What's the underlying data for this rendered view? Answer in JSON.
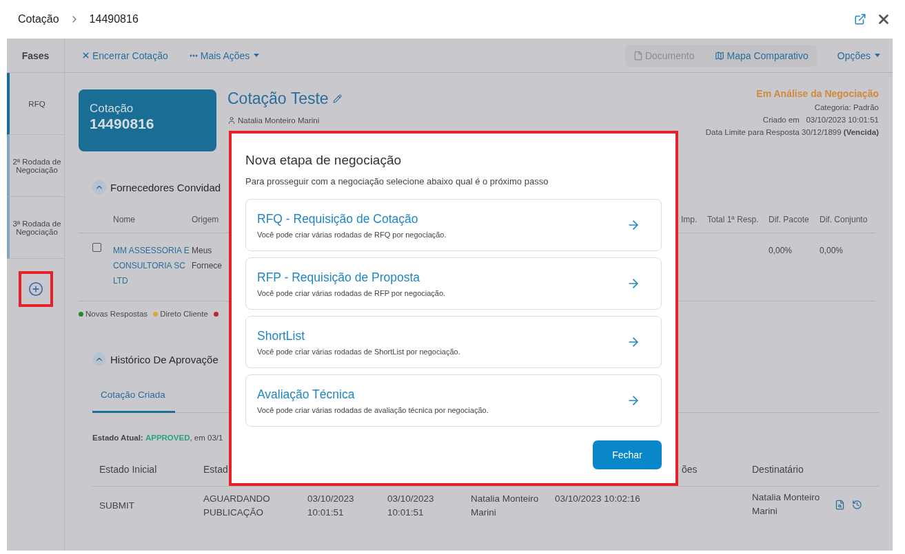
{
  "breadcrumb": [
    "Cotação",
    "14490816"
  ],
  "sidebar": {
    "title": "Fases",
    "items": [
      {
        "label": "RFQ",
        "selected": true
      },
      {
        "label": "2ª Rodada de Negociação",
        "selected": false
      },
      {
        "label": "3ª Rodada de Negociação",
        "selected": false
      }
    ]
  },
  "toolbar": {
    "left": [
      {
        "label": "Encerrar Cotação",
        "kind": "close"
      },
      {
        "label": "Mais Ações",
        "kind": "more"
      }
    ],
    "right": [
      {
        "label": "Documento",
        "kind": "document",
        "disabled": true
      },
      {
        "label": "Mapa Comparativo",
        "kind": "map",
        "disabled": false
      }
    ],
    "options": "Opções"
  },
  "quote": {
    "card_label": "Cotação",
    "card_number": "14490816",
    "title": "Cotação Teste",
    "owner": "Natalia Monteiro Marini",
    "status": "Em Análise da Negociação",
    "category": "Categoria: Padrão",
    "created_label": "Criado em",
    "created_value": "03/10/2023 10:01:51",
    "deadline": "Data Limite para Resposta 30/12/1899 **(Vencida)**"
  },
  "suppliers": {
    "heading": "Fornecedores Convidad",
    "expanded": true,
    "columns": {
      "nome": "Nome",
      "origem": "Origem",
      "column_3": "Imp.",
      "total": "Total 1ª Resp.",
      "pacote": "Dif. Pacote",
      "conjunto": "Dif. Conjunto"
    },
    "rows": [
      {
        "checked": false,
        "name": "MM ASSESSORIA E CONSULTORIA SC LTD",
        "origin": "Meus Fornece",
        "pacote": "0,00%",
        "conjunto": "0,00%"
      }
    ]
  },
  "legend": [
    {
      "label": "Novas Respostas",
      "color": "#1f8a2e"
    },
    {
      "label": "Direto Cliente",
      "color": "#d8a838"
    },
    {
      "color": "#c0282d"
    }
  ],
  "history": {
    "heading": "Histórico De Aprovaçõe",
    "expanded": true,
    "tabs": [
      {
        "label": "Cotação Criada",
        "selected": true
      }
    ],
    "current_label": "Estado Atual:",
    "current_state": "APPROVED",
    "current_rest": ", em 03/1",
    "columns": {
      "estado_inicial": "Estado Inicial",
      "column_2": "Estad",
      "column_7": "ões",
      "destinatario": "Destinatário"
    },
    "rows": [
      {
        "cells": [
          "SUBMIT",
          "AGUARDANDO PUBLICAÇÃO",
          "03/10/2023 10:01:51",
          "03/10/2023 10:01:51",
          "Natalia Monteiro Marini",
          "03/10/2023 10:02:16"
        ],
        "recipient": "Natalia Monteiro Marini"
      }
    ]
  },
  "modal": {
    "title": "Nova etapa de negociação",
    "subtitle": "Para prosseguir com a negociação selecione abaixo qual é o próximo passo",
    "options": [
      {
        "title": "RFQ - Requisição de Cotação",
        "description": "Você pode criar várias rodadas de RFQ por negociação."
      },
      {
        "title": "RFP - Requisição de Proposta",
        "description": "Você pode criar várias rodadas de RFP por negociação."
      },
      {
        "title": "ShortList",
        "description": "Você pode criar várias rodadas de ShortList por negociação."
      },
      {
        "title": "Avaliação Técnica",
        "description": "Você pode criar várias rodadas de avaliação técnica por negociação."
      }
    ],
    "close": "Fechar"
  }
}
